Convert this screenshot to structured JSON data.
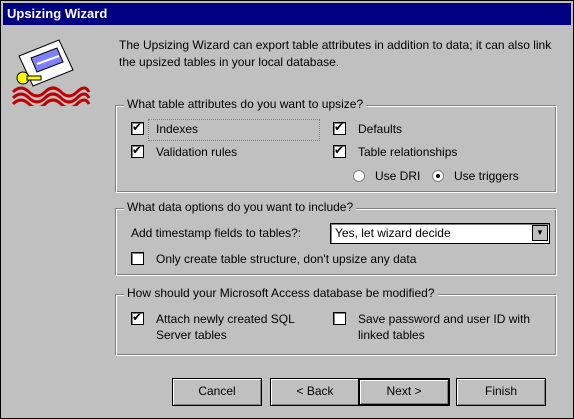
{
  "window": {
    "title": "Upsizing Wizard"
  },
  "intro": "The Upsizing Wizard can export table attributes in addition to data; it can also link the upsized tables in your local database.",
  "attributes_group": {
    "legend": "What table attributes do you want to upsize?",
    "indexes": {
      "label": "Indexes",
      "checked": true
    },
    "validation_rules": {
      "label": "Validation rules",
      "checked": true
    },
    "defaults": {
      "label": "Defaults",
      "checked": true
    },
    "table_relationships": {
      "label": "Table relationships",
      "checked": true
    },
    "use_dri": {
      "label": "Use DRI",
      "selected": false
    },
    "use_triggers": {
      "label": "Use triggers",
      "selected": true
    }
  },
  "data_group": {
    "legend": "What data options do you want to include?",
    "timestamp_label": "Add timestamp fields to tables?:",
    "timestamp_value": "Yes, let wizard decide",
    "structure_only": {
      "label": "Only create table structure, don't upsize any data",
      "checked": false
    }
  },
  "modify_group": {
    "legend": "How should your Microsoft Access database be modified?",
    "attach_tables": {
      "label": "Attach newly created SQL Server tables",
      "checked": true
    },
    "save_password": {
      "label": "Save password and user ID with linked tables",
      "checked": false
    }
  },
  "buttons": {
    "cancel": "Cancel",
    "back": "< Back",
    "next": "Next >",
    "finish": "Finish"
  }
}
